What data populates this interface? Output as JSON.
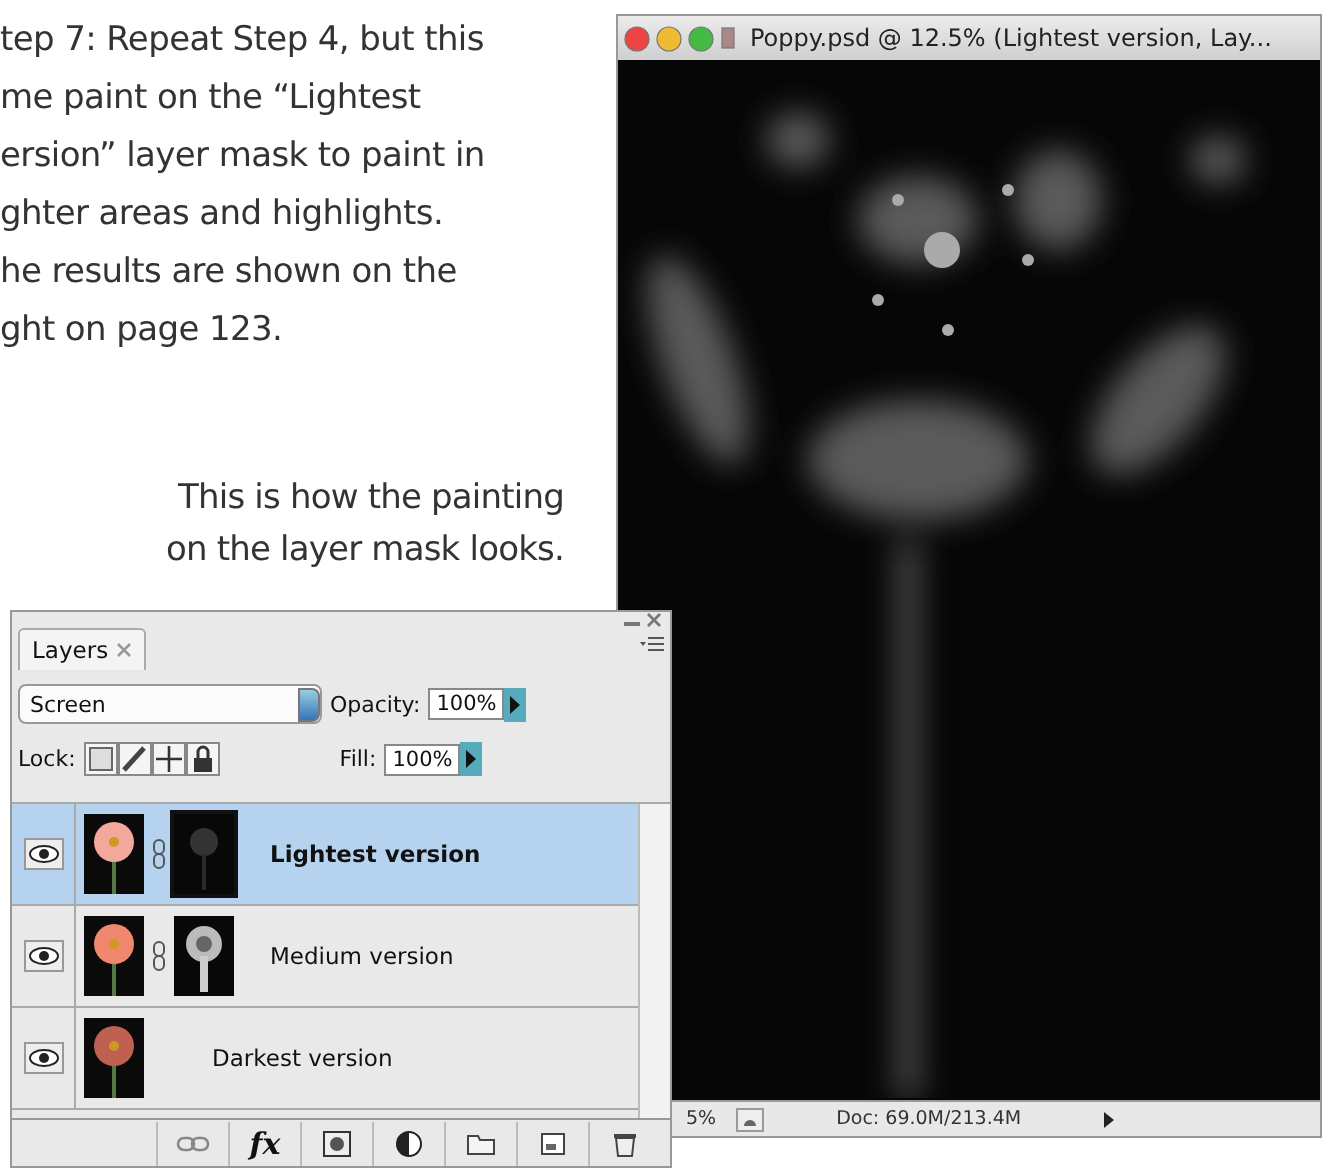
{
  "page": {
    "paragraph_lines": [
      "tep 7: Repeat Step 4, but this",
      "me paint on the “Lightest",
      "ersion” layer mask to paint in",
      "ghter areas and highlights.",
      "he results are shown on the",
      "ght on page 123."
    ],
    "caption_lines": [
      "This is how the painting",
      "on the layer mask looks."
    ]
  },
  "document_window": {
    "title": "Poppy.psd @ 12.5% (Lightest version, Lay...",
    "status_bar": {
      "zoom": "5%",
      "info": "Doc: 69.0M/213.4M"
    }
  },
  "layers_panel": {
    "tabs": [
      {
        "label": "Layers",
        "selected": true
      }
    ],
    "blend_mode": "Screen",
    "opacity_label": "Opacity:",
    "opacity": "100%",
    "lock_label": "Lock:",
    "fill_label": "Fill:",
    "fill": "100%",
    "layers": [
      {
        "name": "Lightest version",
        "selected": true,
        "visible": true,
        "has_mask": true
      },
      {
        "name": "Medium version",
        "selected": false,
        "visible": true,
        "has_mask": true
      },
      {
        "name": "Darkest version",
        "selected": false,
        "visible": true,
        "has_mask": false
      }
    ],
    "fx_label": "fx"
  }
}
